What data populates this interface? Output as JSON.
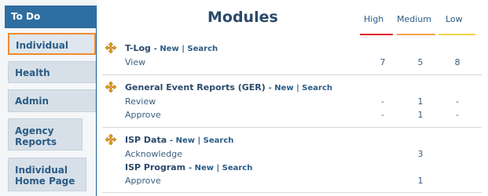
{
  "sidebar": {
    "todo_label": "To Do",
    "items": [
      {
        "label": "Individual"
      },
      {
        "label": "Health"
      },
      {
        "label": "Admin"
      },
      {
        "label": "Agency Reports"
      },
      {
        "label": "Individual Home Page"
      }
    ]
  },
  "main": {
    "title": "Modules",
    "columns": {
      "high": "High",
      "medium": "Medium",
      "low": "Low"
    },
    "colors": {
      "high": "#e0262b",
      "medium": "#f2a14b",
      "low": "#f2d348"
    },
    "sections": [
      {
        "title": "T-Log",
        "link_new": "New",
        "link_sep": "|",
        "link_search": "Search",
        "rows": [
          {
            "label": "View",
            "high": "7",
            "medium": "5",
            "low": "8"
          }
        ]
      },
      {
        "title": "General Event Reports (GER)",
        "link_new": "New",
        "link_sep": "|",
        "link_search": "Search",
        "rows": [
          {
            "label": "Review",
            "high": "-",
            "medium": "1",
            "low": "-"
          },
          {
            "label": "Approve",
            "high": "-",
            "medium": "1",
            "low": "-"
          }
        ]
      },
      {
        "title": "ISP Data",
        "link_new": "New",
        "link_sep": "|",
        "link_search": "Search",
        "rows": [
          {
            "label": "Acknowledge",
            "high": "",
            "medium": "3",
            "low": ""
          }
        ],
        "sub_title": "ISP Program",
        "sub_link_new": "New",
        "sub_link_sep": "|",
        "sub_link_search": "Search",
        "sub_rows": [
          {
            "label": "Approve",
            "high": "",
            "medium": "1",
            "low": ""
          }
        ]
      }
    ]
  }
}
